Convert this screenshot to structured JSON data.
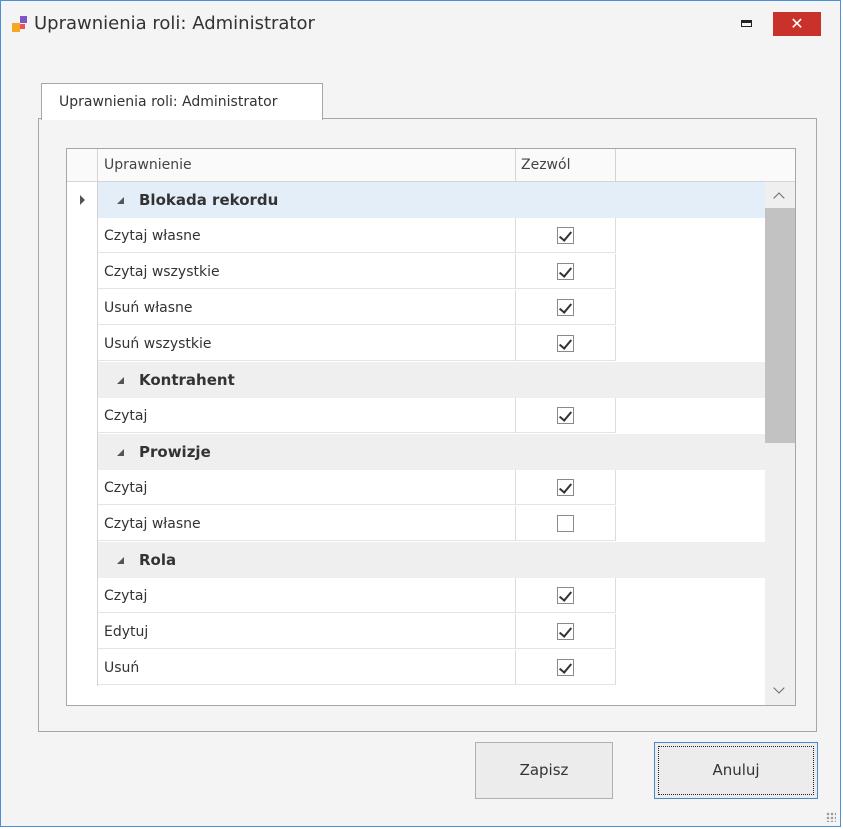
{
  "window": {
    "title": "Uprawnienia roli: Administrator",
    "close_glyph": "✕",
    "icons": [
      "app-icon",
      "maximize-icon",
      "close-icon"
    ]
  },
  "tab": {
    "label": "Uprawnienia roli: Administrator"
  },
  "grid": {
    "columns": {
      "permission": "Uprawnienie",
      "allow": "Zezwól"
    },
    "groups": [
      {
        "label": "Blokada rekordu",
        "selected": true,
        "items": [
          {
            "label": "Czytaj własne",
            "checked": true
          },
          {
            "label": "Czytaj wszystkie",
            "checked": true
          },
          {
            "label": "Usuń własne",
            "checked": true
          },
          {
            "label": "Usuń wszystkie",
            "checked": true
          }
        ]
      },
      {
        "label": "Kontrahent",
        "selected": false,
        "items": [
          {
            "label": "Czytaj",
            "checked": true
          }
        ]
      },
      {
        "label": "Prowizje",
        "selected": false,
        "items": [
          {
            "label": "Czytaj",
            "checked": true
          },
          {
            "label": "Czytaj własne",
            "checked": false
          }
        ]
      },
      {
        "label": "Rola",
        "selected": false,
        "items": [
          {
            "label": "Czytaj",
            "checked": true
          },
          {
            "label": "Edytuj",
            "checked": true
          },
          {
            "label": "Usuń",
            "checked": true
          }
        ]
      }
    ]
  },
  "buttons": {
    "save": "Zapisz",
    "cancel": "Anuluj"
  },
  "colors": {
    "accent": "#4a90d9",
    "close": "#c9312b",
    "selected_row": "#e4eef8"
  }
}
